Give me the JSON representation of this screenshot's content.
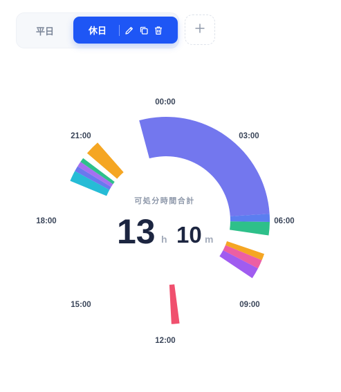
{
  "tabs": {
    "weekday_label": "平日",
    "holiday_label": "休日"
  },
  "icons": {
    "edit": "pencil-icon",
    "copy": "copy-icon",
    "delete": "trash-icon",
    "add": "plus-icon"
  },
  "dial": {
    "hour_labels": [
      "00:00",
      "03:00",
      "06:00",
      "09:00",
      "12:00",
      "15:00",
      "18:00",
      "21:00"
    ],
    "caption": "可処分時間合計",
    "total_hours": "13",
    "hours_unit": "h",
    "total_minutes": "10",
    "minutes_unit": "m"
  },
  "schedule_blocks": [
    {
      "start": "23:00",
      "end": "05:45",
      "color": "#7377ee"
    },
    {
      "start": "05:45",
      "end": "06:03",
      "color": "#5b7ef0"
    },
    {
      "start": "06:03",
      "end": "06:33",
      "color": "#2ec08a"
    },
    {
      "start": "07:15",
      "end": "07:30",
      "color": "#f5a623"
    },
    {
      "start": "07:30",
      "end": "07:50",
      "color": "#ec5fa3"
    },
    {
      "start": "07:50",
      "end": "08:15",
      "color": "#a05cf0"
    },
    {
      "start": "11:30",
      "end": "11:48",
      "color": "#f0506e"
    },
    {
      "start": "19:30",
      "end": "19:54",
      "color": "#26bcd6"
    },
    {
      "start": "19:54",
      "end": "20:06",
      "color": "#6a78ee"
    },
    {
      "start": "20:06",
      "end": "20:18",
      "color": "#a570f0"
    },
    {
      "start": "20:18",
      "end": "20:28",
      "color": "#2ec08a"
    },
    {
      "start": "20:42",
      "end": "21:15",
      "color": "#f5a623"
    }
  ],
  "colors": {
    "accent": "#1e56f5",
    "text_dark": "#1c2540"
  }
}
